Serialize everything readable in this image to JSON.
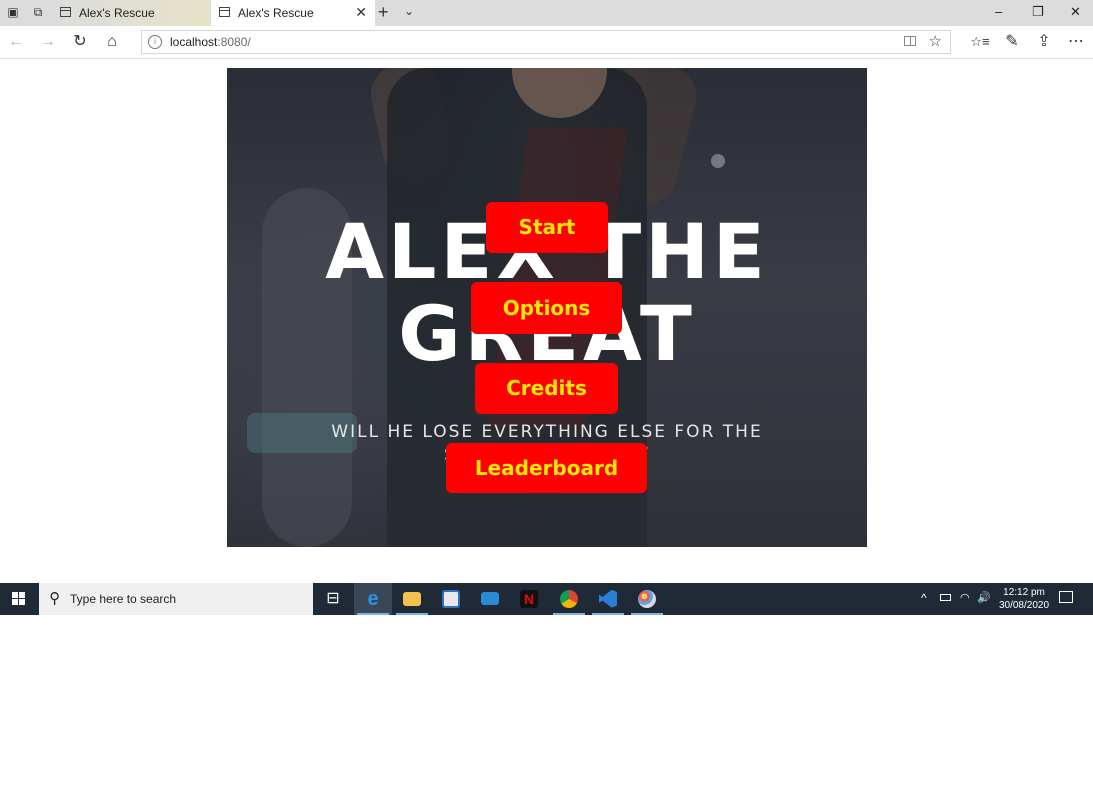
{
  "browser": {
    "tabs": [
      {
        "title": "Alex's Rescue",
        "active": false
      },
      {
        "title": "Alex's Rescue",
        "active": true
      }
    ],
    "address": {
      "host": "localhost",
      "port_path": ":8080/"
    },
    "icons": {
      "tab_actions": "tab-actions-icon",
      "set_aside": "set-aside-tabs-icon",
      "new_tab": "+",
      "tab_list": "⌄",
      "minimize": "–",
      "maximize": "❐",
      "close": "✕",
      "back": "←",
      "forward": "→",
      "refresh": "↻",
      "home": "⌂",
      "favorite": "☆",
      "favorites_bar": "☆≡",
      "notes": "✎",
      "share": "⇪",
      "more": "⋯",
      "tab_close": "✕"
    }
  },
  "game": {
    "title_line1": "ALEX THE",
    "title_line2": "GREAT",
    "subtitle_line1": "WILL HE LOSE EVERYTHING ELSE FOR THE",
    "subtitle_line2": "SAKE OF HIS FAMILY",
    "menu": {
      "start": "Start",
      "options": "Options",
      "credits": "Credits",
      "leaderboard": "Leaderboard"
    },
    "colors": {
      "button_bg": "#ff0000",
      "button_text": "#ffe800"
    }
  },
  "taskbar": {
    "search_placeholder": "Type here to search",
    "apps": [
      "task-view",
      "edge",
      "file-explorer",
      "store",
      "mail",
      "netflix",
      "chrome",
      "vscode",
      "paint"
    ],
    "tray": {
      "chevron": "^",
      "volume": "🔊"
    },
    "time": "12:12 pm",
    "date": "30/08/2020"
  }
}
